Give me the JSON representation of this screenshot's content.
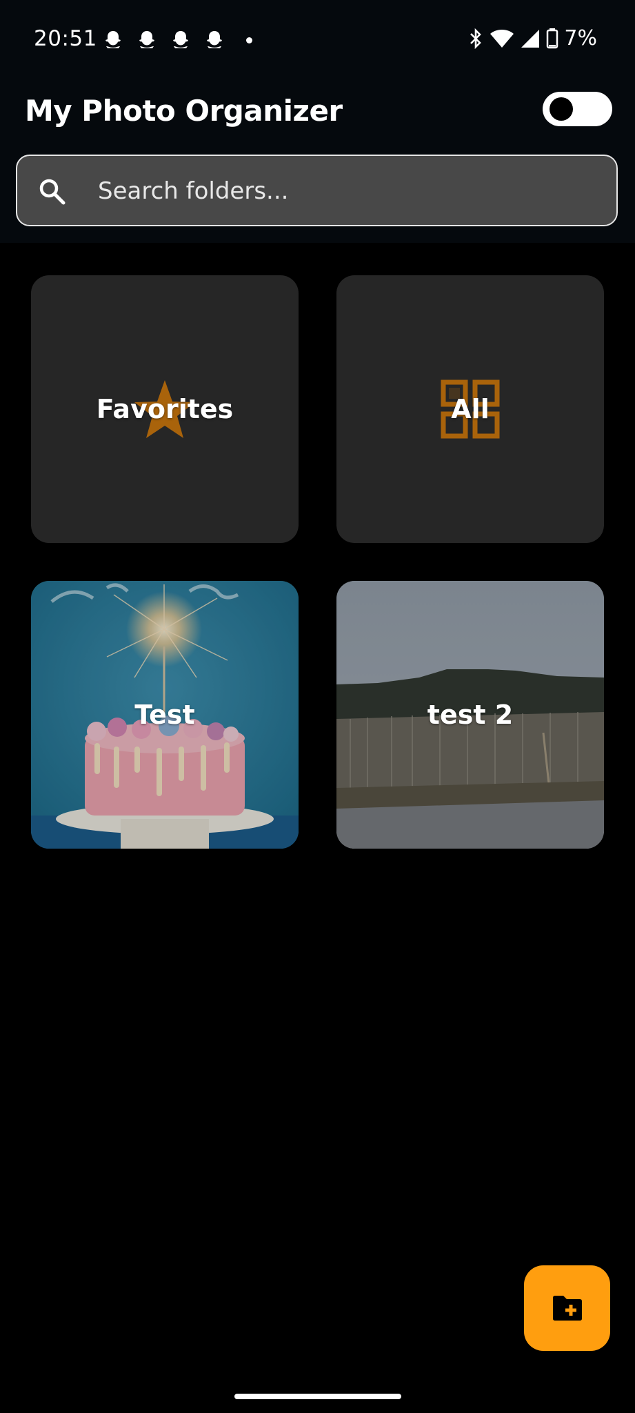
{
  "status_bar": {
    "time": "20:51",
    "notification_icons": [
      "snapchat-icon",
      "snapchat-icon",
      "snapchat-icon",
      "snapchat-icon"
    ],
    "battery": "7%"
  },
  "app": {
    "title": "My Photo Organizer",
    "theme_toggle_on": false
  },
  "search": {
    "placeholder": "Search folders...",
    "value": ""
  },
  "folders": [
    {
      "name": "Favorites",
      "icon": "star-icon"
    },
    {
      "name": "All",
      "icon": "grid-icon"
    },
    {
      "name": "Test",
      "thumbnail": "birthday-cake-photo"
    },
    {
      "name": "test 2",
      "thumbnail": "forest-hill-road-photo"
    }
  ],
  "fab": {
    "icon": "add-folder-icon"
  },
  "colors": {
    "accent": "#ff9e0f",
    "icon_accent": "#a9630b",
    "tile_bg": "#262626",
    "header_bg": "#05090d"
  }
}
